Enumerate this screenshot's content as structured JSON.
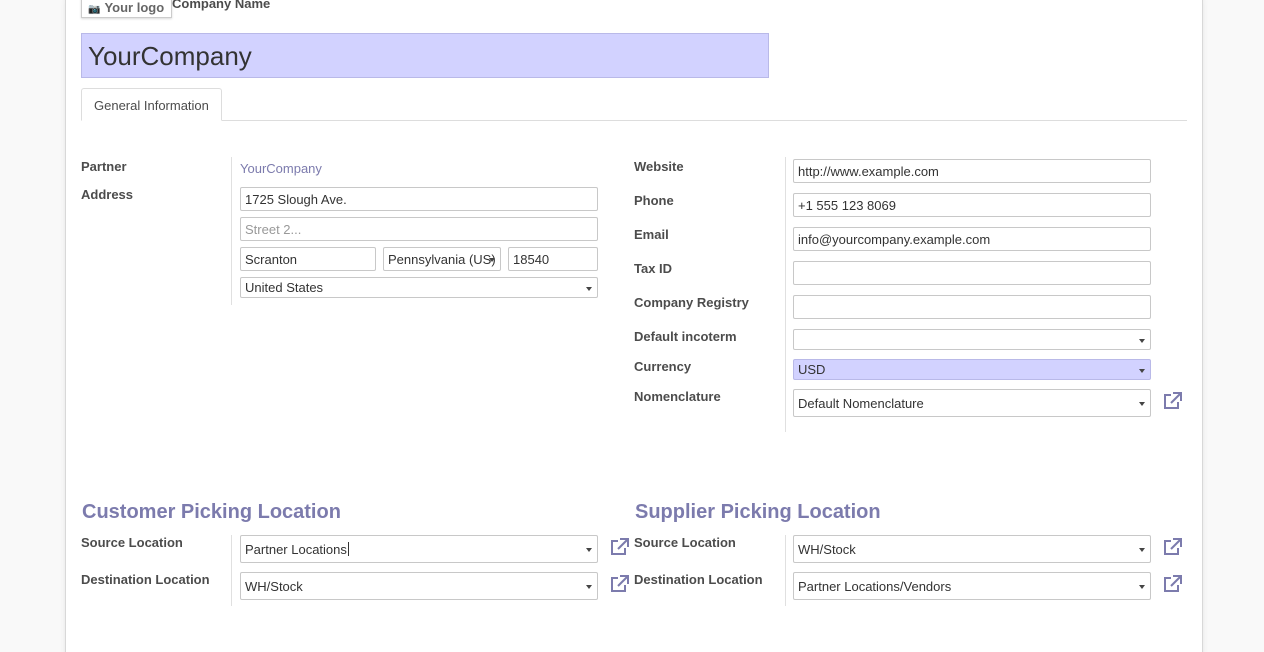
{
  "header": {
    "logo_label": "Your logo",
    "company_name_label": "Company Name",
    "company_name_value": "YourCompany"
  },
  "tabs": [
    {
      "label": "General Information"
    }
  ],
  "left": {
    "partner_label": "Partner",
    "partner_value": "YourCompany",
    "address_label": "Address",
    "street": "1725 Slough Ave.",
    "street2_placeholder": "Street 2...",
    "city": "Scranton",
    "state": "Pennsylvania (US)",
    "zip": "18540",
    "country": "United States"
  },
  "right": {
    "website_label": "Website",
    "website_value": "http://www.example.com",
    "phone_label": "Phone",
    "phone_value": "+1 555 123 8069",
    "email_label": "Email",
    "email_value": "info@yourcompany.example.com",
    "taxid_label": "Tax ID",
    "taxid_value": "",
    "registry_label": "Company Registry",
    "registry_value": "",
    "incoterm_label": "Default incoterm",
    "incoterm_value": "",
    "currency_label": "Currency",
    "currency_value": "USD",
    "nomenclature_label": "Nomenclature",
    "nomenclature_value": "Default Nomenclature"
  },
  "customer_picking": {
    "title": "Customer Picking Location",
    "source_label": "Source Location",
    "source_value": "Partner Locations",
    "dest_label": "Destination Location",
    "dest_value": "WH/Stock"
  },
  "supplier_picking": {
    "title": "Supplier Picking Location",
    "source_label": "Source Location",
    "source_value": "WH/Stock",
    "dest_label": "Destination Location",
    "dest_value": "Partner Locations/Vendors"
  },
  "colors": {
    "accent": "#7c7bad",
    "highlight": "#d2d2ff"
  }
}
